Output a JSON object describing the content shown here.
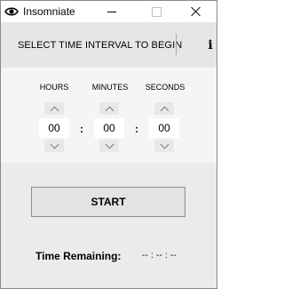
{
  "window": {
    "title": "Insomniate",
    "icon": "eye-icon"
  },
  "header": {
    "instruction": "SELECT TIME INTERVAL TO BEGIN",
    "info_label": "i"
  },
  "time": {
    "hours": {
      "label": "HOURS",
      "value": "00"
    },
    "minutes": {
      "label": "MINUTES",
      "value": "00"
    },
    "seconds": {
      "label": "SECONDS",
      "value": "00"
    },
    "separator": ":"
  },
  "controls": {
    "start_label": "START"
  },
  "status": {
    "remaining_label": "Time Remaining:",
    "remaining_value": "-- : -- : --"
  }
}
